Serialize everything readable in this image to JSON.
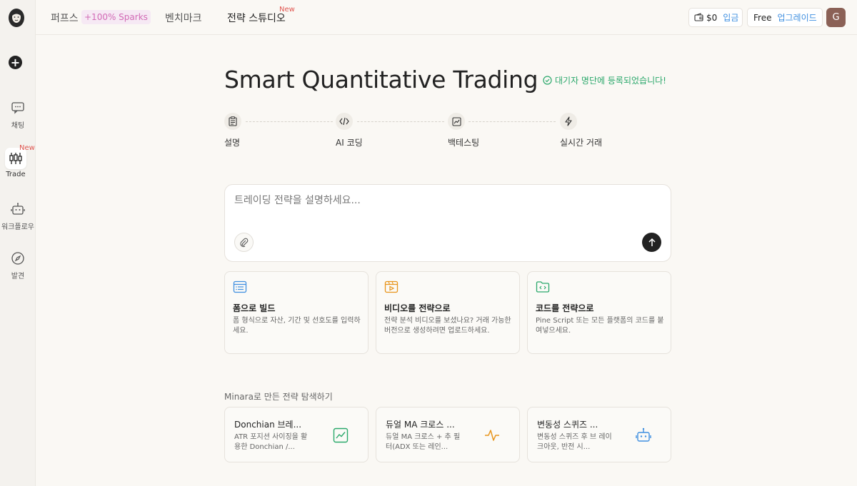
{
  "sidebar": {
    "items": [
      {
        "label": "채팅"
      },
      {
        "label": "Trade",
        "badge": "New"
      },
      {
        "label": "워크플로우"
      },
      {
        "label": "발견"
      }
    ]
  },
  "topbar": {
    "nav": [
      {
        "label": "퍼프스",
        "badge": "+100% Sparks"
      },
      {
        "label": "벤치마크"
      },
      {
        "label": "전략 스튜디오",
        "badge": "New"
      }
    ],
    "wallet": {
      "amount": "$0",
      "deposit": "입금"
    },
    "plan": {
      "name": "Free",
      "upgrade": "업그레이드"
    },
    "avatar_initial": "G"
  },
  "hero": {
    "title": "Smart Quantitative Trading",
    "waitlist": "대기자 명단에 등록되었습니다!"
  },
  "steps": [
    {
      "label": "설명",
      "icon": "clipboard-icon"
    },
    {
      "label": "AI 코딩",
      "icon": "code-icon"
    },
    {
      "label": "백테스팅",
      "icon": "chart-icon"
    },
    {
      "label": "실시간 거래",
      "icon": "lightning-icon"
    }
  ],
  "prompt": {
    "placeholder": "트레이딩 전략을 설명하세요..."
  },
  "cards": [
    {
      "title": "폼으로 빌드",
      "desc": "폼 형식으로 자산, 기간 및 선호도를 입력하세요.",
      "color": "#3f8fe0"
    },
    {
      "title": "비디오를 전략으로",
      "desc": "전략 분석 비디오를 보셨나요? 거래 가능한 버전으로 생성하려면 업로드하세요.",
      "color": "#e8951c"
    },
    {
      "title": "코드를 전략으로",
      "desc": "Pine Script 또는 모든 플랫폼의 코드를 붙여넣으세요.",
      "color": "#2aa86b"
    }
  ],
  "explore": {
    "label": "Minara로 만든 전략 탐색하기",
    "items": [
      {
        "title": "Donchian 브레...",
        "desc": "ATR 포지션 사이징을 활용한 Donchian /...",
        "color": "#2aa86b"
      },
      {
        "title": "듀얼 MA 크로스 ...",
        "desc": "듀얼 MA 크로스 + 추 필터(ADX 또는 레인...",
        "color": "#e8951c"
      },
      {
        "title": "변동성 스퀴즈 ...",
        "desc": "변동성 스퀴즈 후 브 레이크아웃, 반전 시...",
        "color": "#3f8fe0"
      }
    ]
  }
}
